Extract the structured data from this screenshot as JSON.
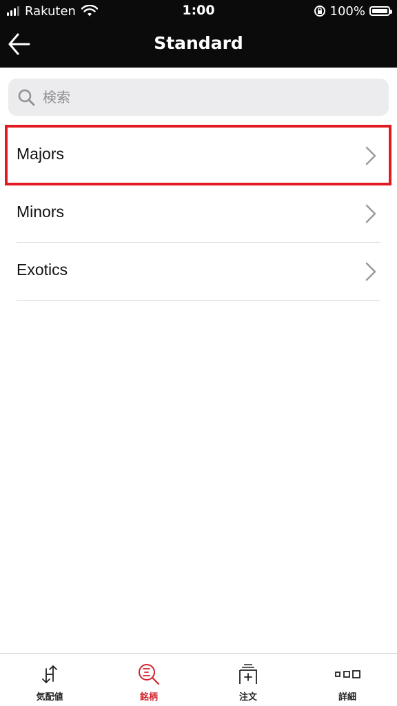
{
  "status_bar": {
    "carrier": "Rakuten",
    "time": "1:00",
    "battery": "100%",
    "icons": [
      "signal-icon",
      "wifi-icon",
      "orientation-lock-icon",
      "battery-icon"
    ]
  },
  "nav": {
    "title": "Standard",
    "back_icon": "back-arrow-icon"
  },
  "search": {
    "placeholder": "検索",
    "value": ""
  },
  "list": {
    "items": [
      {
        "label": "Majors",
        "highlighted": true
      },
      {
        "label": "Minors",
        "highlighted": false
      },
      {
        "label": "Exotics",
        "highlighted": false
      }
    ]
  },
  "tabbar": {
    "items": [
      {
        "label": "気配値",
        "icon": "quotes-icon",
        "active": false
      },
      {
        "label": "銘柄",
        "icon": "symbol-search-icon",
        "active": true
      },
      {
        "label": "注文",
        "icon": "new-order-icon",
        "active": false
      },
      {
        "label": "詳細",
        "icon": "details-icon",
        "active": false
      }
    ]
  },
  "colors": {
    "header_bg": "#0b0b0b",
    "accent_red": "#d2232a",
    "highlight_border": "#e11a22",
    "search_bg": "#ececee"
  }
}
